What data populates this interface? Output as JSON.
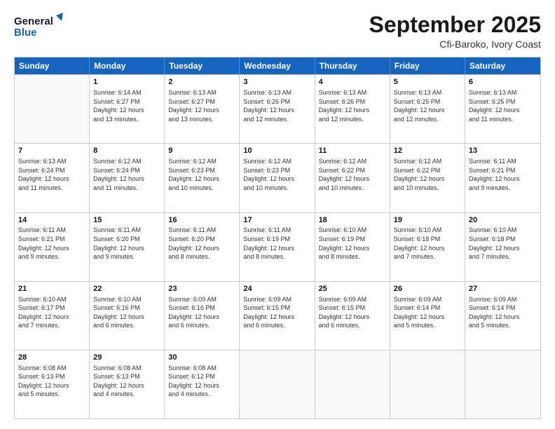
{
  "logo": {
    "line1": "General",
    "line2": "Blue"
  },
  "title": "September 2025",
  "subtitle": "Cfi-Baroko, Ivory Coast",
  "header_days": [
    "Sunday",
    "Monday",
    "Tuesday",
    "Wednesday",
    "Thursday",
    "Friday",
    "Saturday"
  ],
  "weeks": [
    [
      {
        "day": "",
        "info": ""
      },
      {
        "day": "1",
        "info": "Sunrise: 6:14 AM\nSunset: 6:27 PM\nDaylight: 12 hours\nand 13 minutes."
      },
      {
        "day": "2",
        "info": "Sunrise: 6:13 AM\nSunset: 6:27 PM\nDaylight: 12 hours\nand 13 minutes."
      },
      {
        "day": "3",
        "info": "Sunrise: 6:13 AM\nSunset: 6:26 PM\nDaylight: 12 hours\nand 12 minutes."
      },
      {
        "day": "4",
        "info": "Sunrise: 6:13 AM\nSunset: 6:26 PM\nDaylight: 12 hours\nand 12 minutes."
      },
      {
        "day": "5",
        "info": "Sunrise: 6:13 AM\nSunset: 6:25 PM\nDaylight: 12 hours\nand 12 minutes."
      },
      {
        "day": "6",
        "info": "Sunrise: 6:13 AM\nSunset: 6:25 PM\nDaylight: 12 hours\nand 11 minutes."
      }
    ],
    [
      {
        "day": "7",
        "info": "Sunrise: 6:13 AM\nSunset: 6:24 PM\nDaylight: 12 hours\nand 11 minutes."
      },
      {
        "day": "8",
        "info": "Sunrise: 6:12 AM\nSunset: 6:24 PM\nDaylight: 12 hours\nand 11 minutes."
      },
      {
        "day": "9",
        "info": "Sunrise: 6:12 AM\nSunset: 6:23 PM\nDaylight: 12 hours\nand 10 minutes."
      },
      {
        "day": "10",
        "info": "Sunrise: 6:12 AM\nSunset: 6:23 PM\nDaylight: 12 hours\nand 10 minutes."
      },
      {
        "day": "11",
        "info": "Sunrise: 6:12 AM\nSunset: 6:22 PM\nDaylight: 12 hours\nand 10 minutes."
      },
      {
        "day": "12",
        "info": "Sunrise: 6:12 AM\nSunset: 6:22 PM\nDaylight: 12 hours\nand 10 minutes."
      },
      {
        "day": "13",
        "info": "Sunrise: 6:11 AM\nSunset: 6:21 PM\nDaylight: 12 hours\nand 9 minutes."
      }
    ],
    [
      {
        "day": "14",
        "info": "Sunrise: 6:11 AM\nSunset: 6:21 PM\nDaylight: 12 hours\nand 9 minutes."
      },
      {
        "day": "15",
        "info": "Sunrise: 6:11 AM\nSunset: 6:20 PM\nDaylight: 12 hours\nand 9 minutes."
      },
      {
        "day": "16",
        "info": "Sunrise: 6:11 AM\nSunset: 6:20 PM\nDaylight: 12 hours\nand 8 minutes."
      },
      {
        "day": "17",
        "info": "Sunrise: 6:11 AM\nSunset: 6:19 PM\nDaylight: 12 hours\nand 8 minutes."
      },
      {
        "day": "18",
        "info": "Sunrise: 6:10 AM\nSunset: 6:19 PM\nDaylight: 12 hours\nand 8 minutes."
      },
      {
        "day": "19",
        "info": "Sunrise: 6:10 AM\nSunset: 6:18 PM\nDaylight: 12 hours\nand 7 minutes."
      },
      {
        "day": "20",
        "info": "Sunrise: 6:10 AM\nSunset: 6:18 PM\nDaylight: 12 hours\nand 7 minutes."
      }
    ],
    [
      {
        "day": "21",
        "info": "Sunrise: 6:10 AM\nSunset: 6:17 PM\nDaylight: 12 hours\nand 7 minutes."
      },
      {
        "day": "22",
        "info": "Sunrise: 6:10 AM\nSunset: 6:16 PM\nDaylight: 12 hours\nand 6 minutes."
      },
      {
        "day": "23",
        "info": "Sunrise: 6:09 AM\nSunset: 6:16 PM\nDaylight: 12 hours\nand 6 minutes."
      },
      {
        "day": "24",
        "info": "Sunrise: 6:09 AM\nSunset: 6:15 PM\nDaylight: 12 hours\nand 6 minutes."
      },
      {
        "day": "25",
        "info": "Sunrise: 6:09 AM\nSunset: 6:15 PM\nDaylight: 12 hours\nand 6 minutes."
      },
      {
        "day": "26",
        "info": "Sunrise: 6:09 AM\nSunset: 6:14 PM\nDaylight: 12 hours\nand 5 minutes."
      },
      {
        "day": "27",
        "info": "Sunrise: 6:09 AM\nSunset: 6:14 PM\nDaylight: 12 hours\nand 5 minutes."
      }
    ],
    [
      {
        "day": "28",
        "info": "Sunrise: 6:08 AM\nSunset: 6:13 PM\nDaylight: 12 hours\nand 5 minutes."
      },
      {
        "day": "29",
        "info": "Sunrise: 6:08 AM\nSunset: 6:13 PM\nDaylight: 12 hours\nand 4 minutes."
      },
      {
        "day": "30",
        "info": "Sunrise: 6:08 AM\nSunset: 6:12 PM\nDaylight: 12 hours\nand 4 minutes."
      },
      {
        "day": "",
        "info": ""
      },
      {
        "day": "",
        "info": ""
      },
      {
        "day": "",
        "info": ""
      },
      {
        "day": "",
        "info": ""
      }
    ]
  ]
}
